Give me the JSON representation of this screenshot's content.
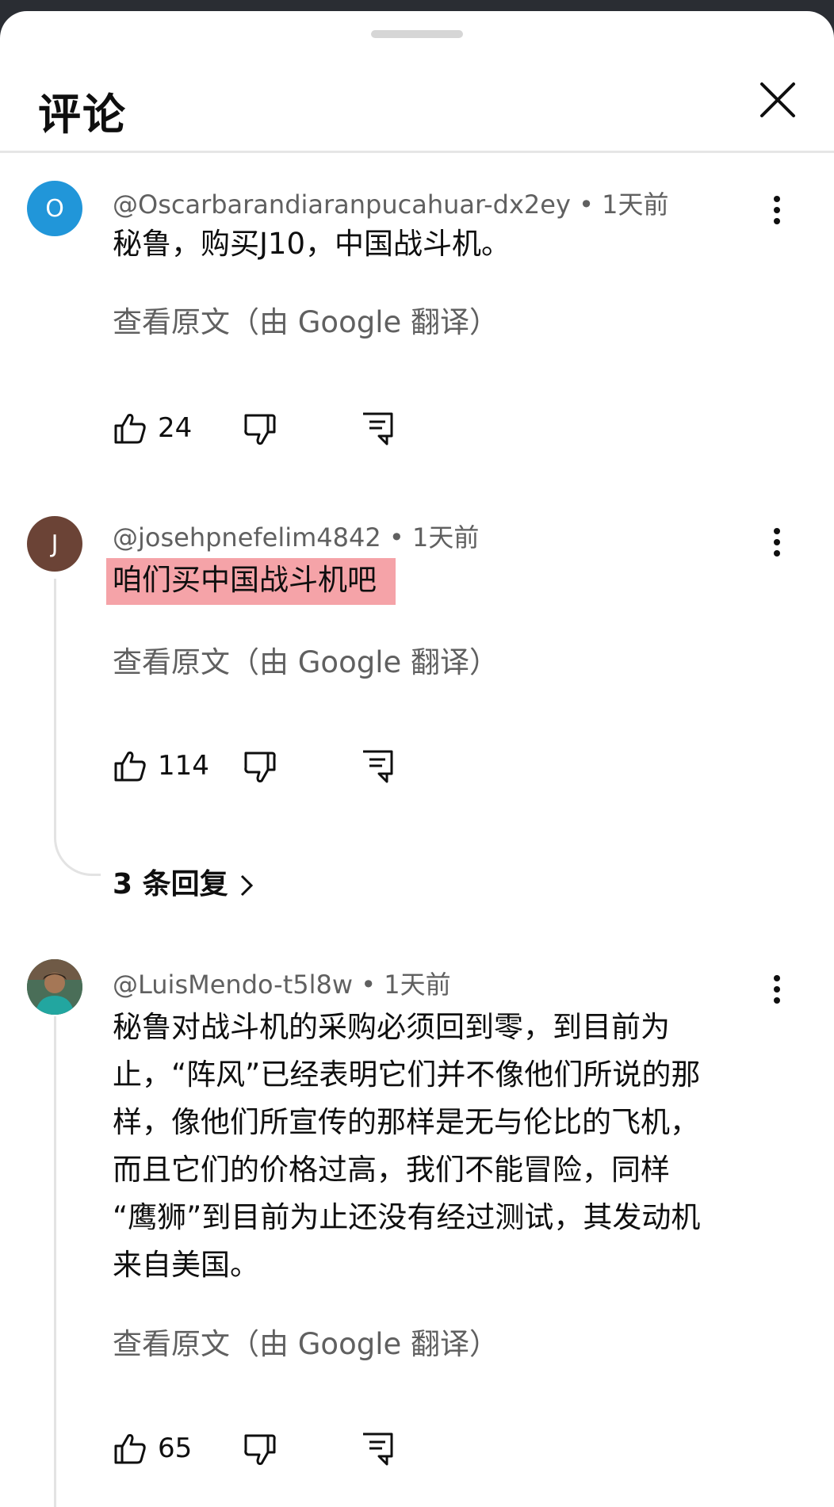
{
  "header": {
    "title": "评论",
    "close_icon": "close-icon"
  },
  "comments": [
    {
      "avatar_letter": "O",
      "avatar_color": "#2196d9",
      "author": "@Oscarbarandiaranpucahuar-dx2ey",
      "time": "1天前",
      "text": "秘鲁，购买J10，中国战斗机。",
      "translate": "查看原文（由 Google 翻译）",
      "likes": "24"
    },
    {
      "avatar_letter": "J",
      "avatar_color": "#6b4336",
      "author": "@josehpnefelim4842",
      "time": "1天前",
      "text": "咱们买中国战斗机吧",
      "highlighted": true,
      "translate": "查看原文（由 Google 翻译）",
      "likes": "114",
      "replies": "3 条回复"
    },
    {
      "avatar_type": "photo",
      "author": "@LuisMendo-t5l8w",
      "time": "1天前",
      "text_lines": [
        "秘鲁对战斗机的采购必须回到零，到目前为",
        "止，“阵风”已经表明它们并不像他们所说的那",
        "样，像他们所宣传的那样是无与伦比的飞机，",
        "而且它们的价格过高，我们不能冒险，同样",
        "“鹰狮”到目前为止还没有经过测试，其发动机",
        "来自美国。"
      ],
      "translate": "查看原文（由 Google 翻译）",
      "likes": "65"
    }
  ],
  "colors": {
    "text": "#0f0f0f",
    "meta": "#606060",
    "highlight": "#f5a3a8",
    "divider": "#e6e6e6"
  },
  "separator": "•"
}
